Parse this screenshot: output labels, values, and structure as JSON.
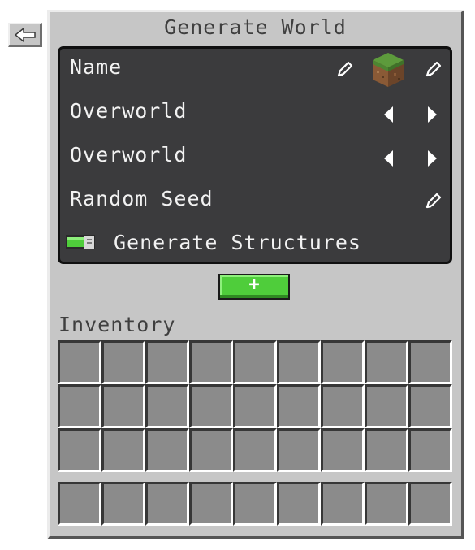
{
  "screen": {
    "title": "Generate World",
    "back_icon": "arrow-left-icon"
  },
  "settings": {
    "name_label": "Name",
    "dimension_1": "Overworld",
    "dimension_2": "Overworld",
    "seed_label": "Random Seed",
    "structures_label": "Generate Structures",
    "structures_enabled": true,
    "world_icon": "grass-block-icon"
  },
  "add_button": {
    "label": "+"
  },
  "inventory": {
    "label": "Inventory",
    "main_rows": 3,
    "columns": 9,
    "hotbar_slots": 9
  },
  "colors": {
    "panel": "#c6c6c6",
    "settings_bg": "#3b3b3d",
    "slot": "#8b8b8b",
    "add_button": "#4fcd3b",
    "toggle_on": "#4fcd3b"
  }
}
